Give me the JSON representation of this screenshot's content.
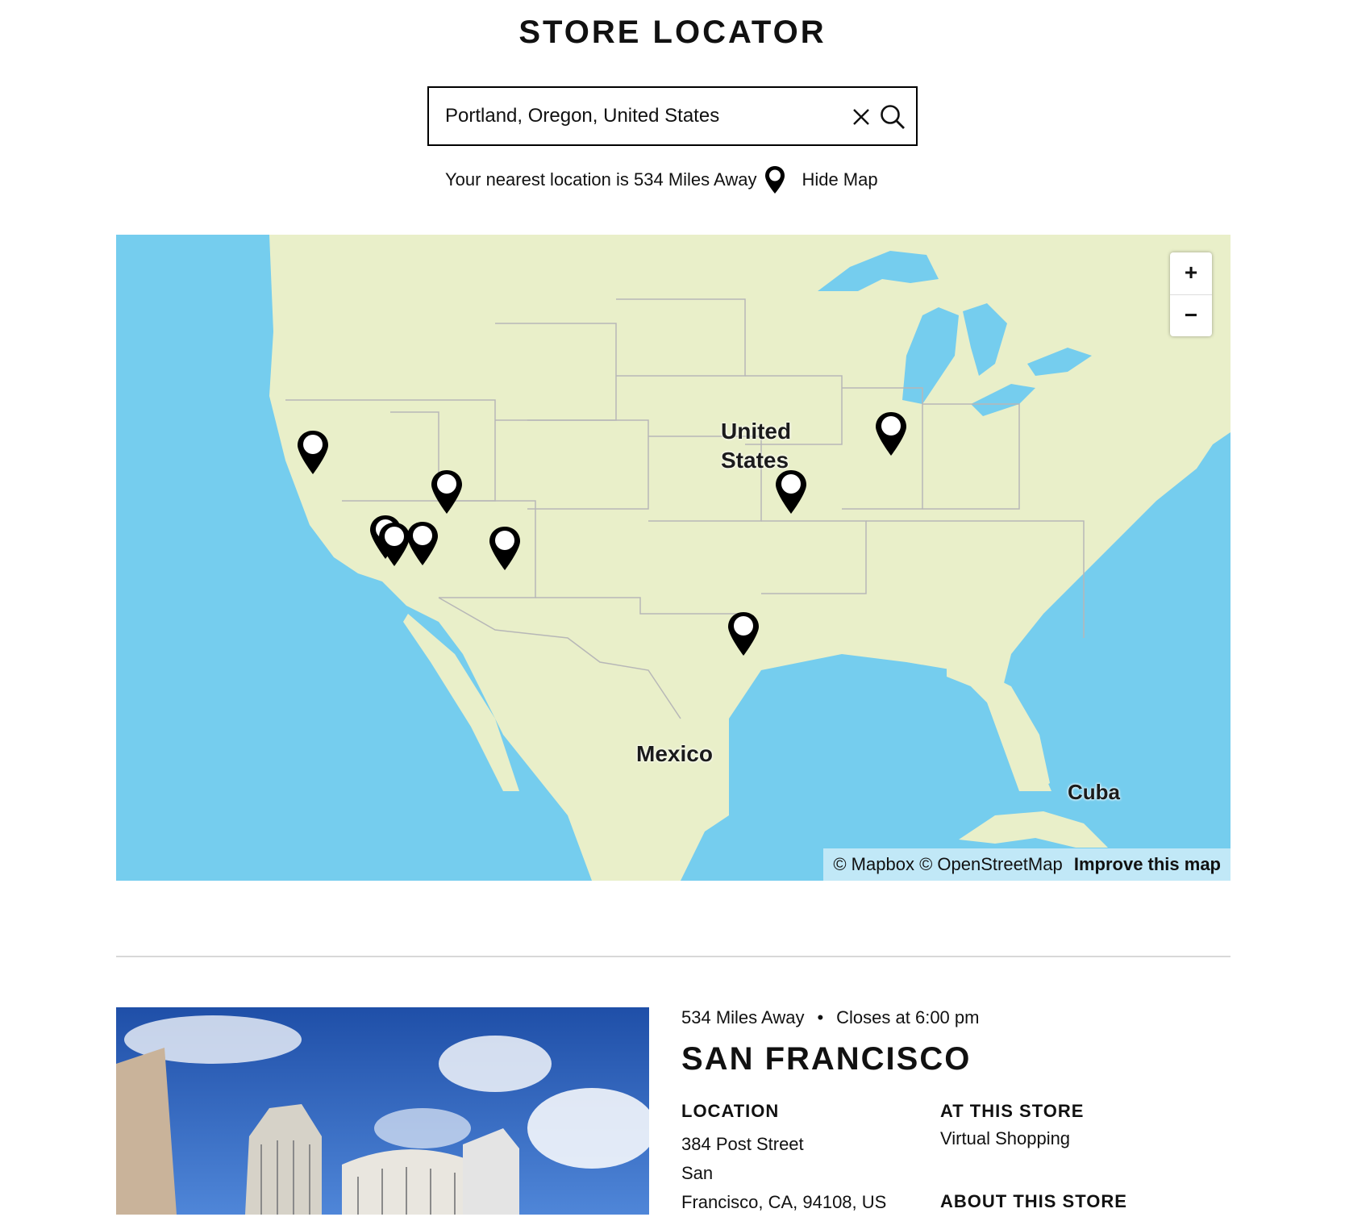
{
  "header": {
    "title": "STORE LOCATOR"
  },
  "search": {
    "value": "Portland, Oregon, United States"
  },
  "nearest": {
    "text": "Your nearest location is 534 Miles Away",
    "hide_map_label": "Hide Map"
  },
  "map": {
    "labels": {
      "us": "United\nStates",
      "mexico": "Mexico",
      "cuba": "Cuba"
    },
    "zoom": {
      "in": "+",
      "out": "−"
    },
    "attribution": {
      "mapbox": "© Mapbox",
      "osm": "© OpenStreetMap",
      "improve": "Improve this map"
    },
    "marker_count": 10,
    "colors": {
      "water": "#75cdee",
      "land": "#e9efc9",
      "marker": "#000000"
    }
  },
  "store": {
    "distance": "534 Miles Away",
    "hours": "Closes at 6:00 pm",
    "name": "SAN FRANCISCO",
    "location_heading": "LOCATION",
    "address_line1": "384 Post Street",
    "address_line2": "San",
    "address_line3": "Francisco, CA, 94108, US",
    "services_heading": "AT THIS STORE",
    "services": "Virtual Shopping",
    "about_heading": "ABOUT THIS STORE"
  }
}
